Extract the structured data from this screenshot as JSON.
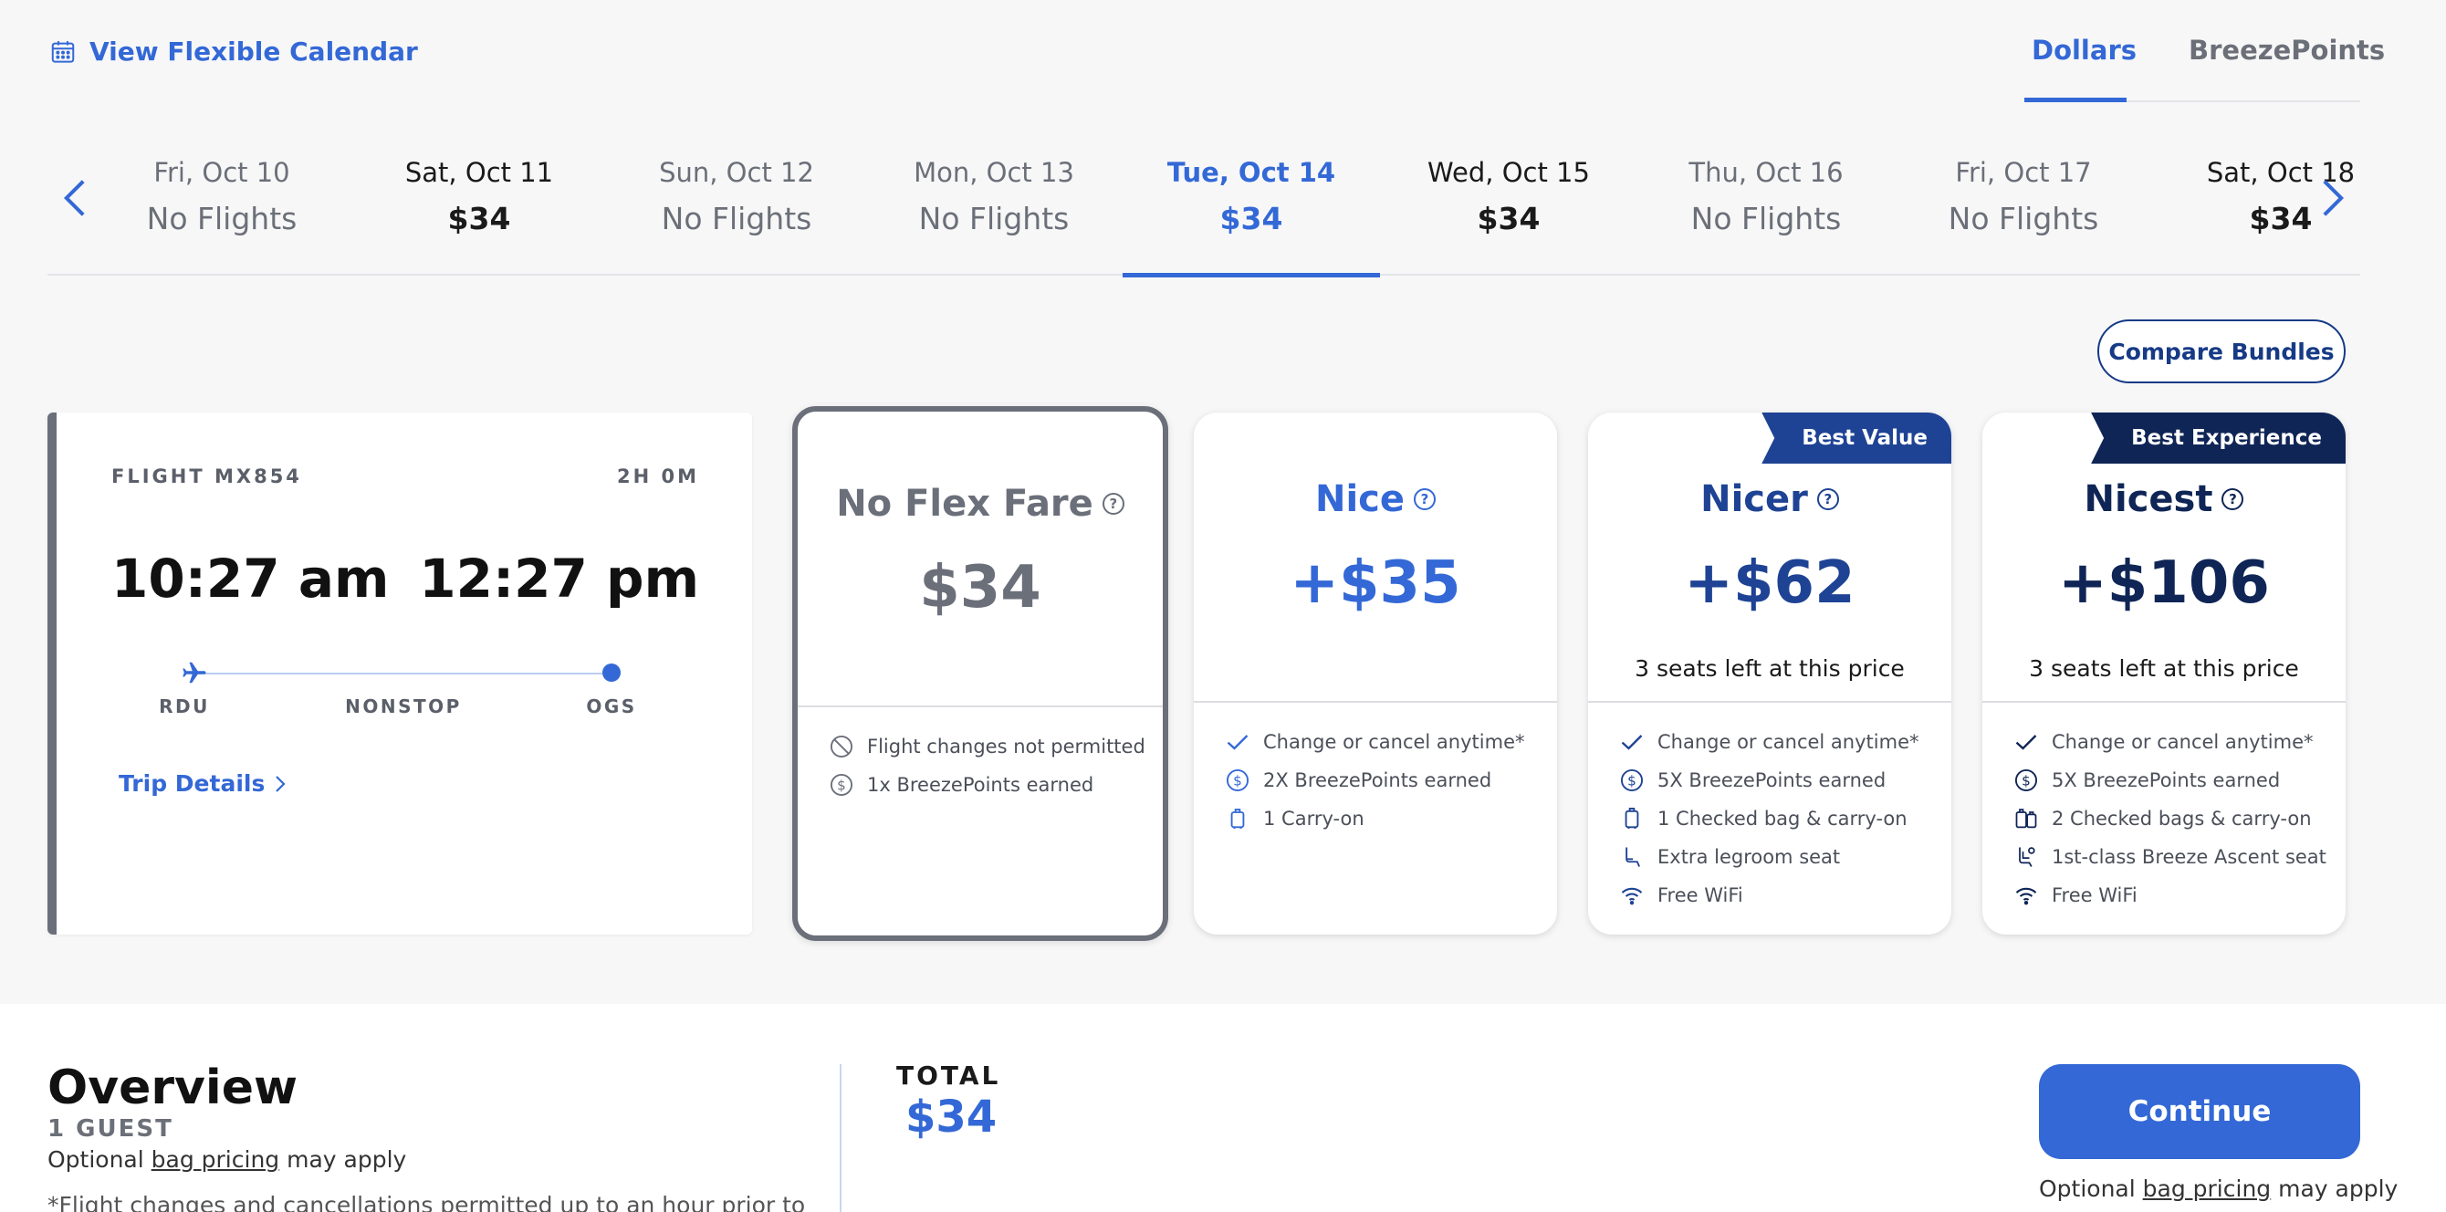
{
  "header": {
    "flex_calendar_label": "View Flexible Calendar",
    "currency_tabs": [
      {
        "label": "Dollars",
        "active": true
      },
      {
        "label": "BreezePoints",
        "active": false
      }
    ]
  },
  "dates": [
    {
      "date": "Fri, Oct 10",
      "price": "No Flights"
    },
    {
      "date": "Sat, Oct 11",
      "price": "$34"
    },
    {
      "date": "Sun, Oct 12",
      "price": "No Flights"
    },
    {
      "date": "Mon, Oct 13",
      "price": "No Flights"
    },
    {
      "date": "Tue, Oct 14",
      "price": "$34",
      "selected": true
    },
    {
      "date": "Wed, Oct 15",
      "price": "$34"
    },
    {
      "date": "Thu, Oct 16",
      "price": "No Flights"
    },
    {
      "date": "Fri, Oct 17",
      "price": "No Flights"
    },
    {
      "date": "Sat, Oct 18",
      "price": "$34"
    }
  ],
  "compare_bundles_label": "Compare Bundles",
  "flight": {
    "number": "FLIGHT MX854",
    "duration": "2H 0M",
    "depart_time": "10:27 am",
    "arrive_time": "12:27 pm",
    "origin": "RDU",
    "stops": "NONSTOP",
    "destination": "OGS",
    "trip_details_label": "Trip Details"
  },
  "bundles": [
    {
      "name": "No Flex Fare",
      "price": "$34",
      "seats_left": "",
      "badge": "",
      "features": [
        {
          "icon": "prohibited-icon",
          "text": "Flight changes not permitted"
        },
        {
          "icon": "dollar-circle-icon",
          "text": "1x BreezePoints earned"
        }
      ]
    },
    {
      "name": "Nice",
      "price": "+$35",
      "seats_left": "",
      "badge": "",
      "features": [
        {
          "icon": "check-icon",
          "text": "Change or cancel anytime*"
        },
        {
          "icon": "dollar-circle-icon",
          "text": "2X BreezePoints earned"
        },
        {
          "icon": "carry-on-bag-icon",
          "text": "1 Carry-on"
        }
      ]
    },
    {
      "name": "Nicer",
      "price": "+$62",
      "seats_left": "3 seats left at this price",
      "badge": "Best Value",
      "features": [
        {
          "icon": "check-icon",
          "text": "Change or cancel anytime*"
        },
        {
          "icon": "dollar-circle-icon",
          "text": "5X BreezePoints earned"
        },
        {
          "icon": "checked-bag-icon",
          "text": "1 Checked bag & carry-on"
        },
        {
          "icon": "legroom-seat-icon",
          "text": "Extra legroom seat"
        },
        {
          "icon": "wifi-icon",
          "text": "Free WiFi"
        }
      ]
    },
    {
      "name": "Nicest",
      "price": "+$106",
      "seats_left": "3 seats left at this price",
      "badge": "Best Experience",
      "features": [
        {
          "icon": "check-icon",
          "text": "Change or cancel anytime*"
        },
        {
          "icon": "dollar-circle-icon",
          "text": "5X BreezePoints earned"
        },
        {
          "icon": "two-bags-icon",
          "text": "2 Checked bags & carry-on"
        },
        {
          "icon": "ascent-seat-icon",
          "text": "1st-class Breeze Ascent seat"
        },
        {
          "icon": "wifi-icon",
          "text": "Free WiFi"
        }
      ]
    }
  ],
  "colors": {
    "accent": "#3368d6",
    "navy": "#163a86",
    "nicer": "#1e4394",
    "nicest": "#0f2556",
    "grey": "#6b6f7a",
    "badge_value": "#1e4394",
    "badge_experience": "#0f2556"
  },
  "overview": {
    "title": "Overview",
    "guests": "1 GUEST",
    "optional_prefix": "Optional",
    "bag_pricing_link": "bag pricing",
    "optional_suffix": "may apply",
    "note": "*Flight changes and cancellations permitted up to an hour prior to",
    "total_label": "TOTAL",
    "total_value": "$34",
    "continue_label": "Continue"
  }
}
